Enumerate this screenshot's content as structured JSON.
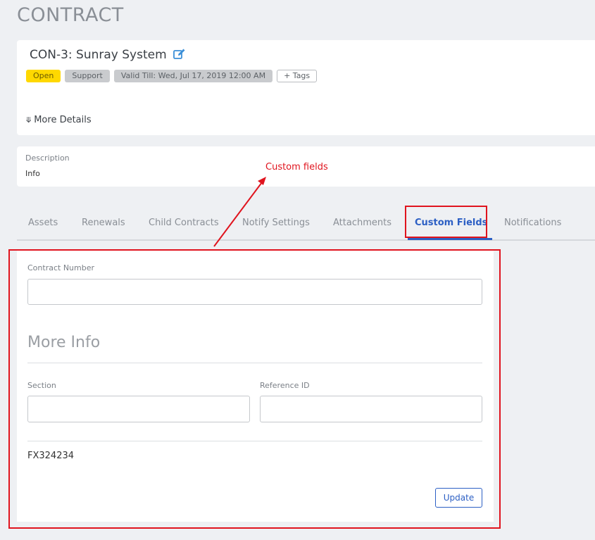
{
  "page": {
    "title": "CONTRACT"
  },
  "contract": {
    "name": "CON-3: Sunray System",
    "badges": {
      "status": "Open",
      "type": "Support",
      "valid_till": "Valid Till: Wed, Jul 17, 2019 12:00 AM",
      "tags": "+ Tags"
    },
    "more_details": "More Details"
  },
  "description": {
    "label": "Description",
    "value": "Info"
  },
  "annotation": {
    "text": "Custom fields",
    "color": "#e0141e"
  },
  "tabs": [
    {
      "label": "Assets"
    },
    {
      "label": "Renewals"
    },
    {
      "label": "Child Contracts"
    },
    {
      "label": "Notify Settings"
    },
    {
      "label": "Attachments"
    },
    {
      "label": "Custom Fields",
      "active": true
    },
    {
      "label": "Notifications"
    }
  ],
  "custom_fields": {
    "contract_number": {
      "label": "Contract Number",
      "value": ""
    },
    "section_title": "More Info",
    "section": {
      "label": "Section",
      "value": ""
    },
    "reference_id": {
      "label": "Reference ID",
      "value": ""
    },
    "code_value": "FX324234",
    "update_label": "Update"
  },
  "colors": {
    "accent": "#2c5fc4",
    "status_open": "#ffd800",
    "highlight": "#e0141e"
  }
}
